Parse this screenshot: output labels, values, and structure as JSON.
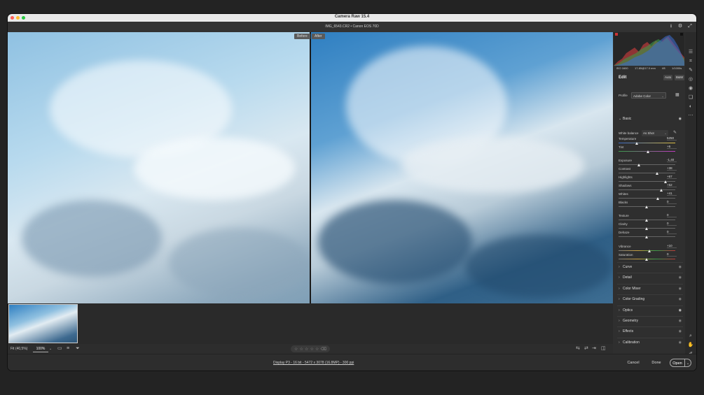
{
  "window": {
    "title": "Camera Raw 15.4",
    "traffic_colors": [
      "#ff5f57",
      "#febc2e",
      "#28c840"
    ]
  },
  "file": {
    "label": "IMG_6543.CR2  •  Canon EOS 70D"
  },
  "viewer": {
    "before_label": "Before",
    "after_label": "After"
  },
  "bottom": {
    "fit_label": "Fit (40,5%)",
    "zoom_value": "100%"
  },
  "footer": {
    "workflow_link": "Display P3 - 16 bit - 5472 x 3078 (16.8MP) - 300 ppi",
    "cancel": "Cancel",
    "done": "Done",
    "open": "Open"
  },
  "camera": {
    "iso": "ISO 1600",
    "lens": "17-85@17.0 mm",
    "aperture": "f/8",
    "shutter": "1/1000s"
  },
  "edit": {
    "title": "Edit",
    "auto": "Auto",
    "bw": "B&W"
  },
  "profile": {
    "label": "Profile",
    "value": "Adobe Color"
  },
  "basic": {
    "title": "Basic",
    "white_balance_label": "White balance",
    "white_balance_value": "As Shot",
    "sliders": [
      {
        "label": "Temperature",
        "value": "5250",
        "pos": 0.33
      },
      {
        "label": "Tint",
        "value": "+6",
        "pos": 0.53
      },
      {
        "label": "Exposure",
        "value": "-1,40",
        "pos": 0.36
      },
      {
        "label": "Contrast",
        "value": "+38",
        "pos": 0.69
      },
      {
        "label": "Highlights",
        "value": "+67",
        "pos": 0.83
      },
      {
        "label": "Shadows",
        "value": "+52",
        "pos": 0.76
      },
      {
        "label": "Whites",
        "value": "+41",
        "pos": 0.7
      },
      {
        "label": "Blacks",
        "value": "0",
        "pos": 0.5
      },
      {
        "label": "Texture",
        "value": "0",
        "pos": 0.5
      },
      {
        "label": "Clarity",
        "value": "0",
        "pos": 0.5
      },
      {
        "label": "Dehaze",
        "value": "0",
        "pos": 0.5
      },
      {
        "label": "Vibrance",
        "value": "+10",
        "pos": 0.55
      },
      {
        "label": "Saturation",
        "value": "0",
        "pos": 0.5
      }
    ]
  },
  "sections": [
    "Curve",
    "Detail",
    "Color Mixer",
    "Color Grading",
    "Optics",
    "Geometry",
    "Effects",
    "Calibration"
  ]
}
